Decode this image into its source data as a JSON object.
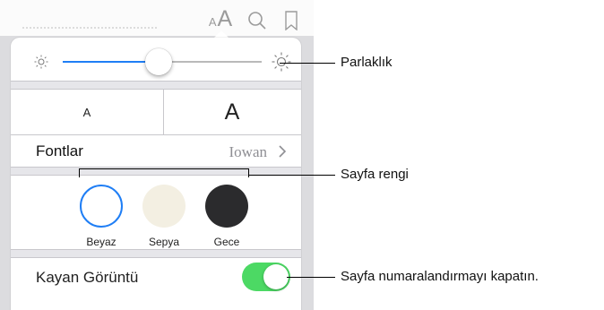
{
  "toolbar": {
    "font_small_glyph": "A",
    "font_large_glyph": "A",
    "icons": [
      "font-size-icon",
      "search-icon",
      "bookmark-icon"
    ]
  },
  "brightness": {
    "level": 0.48,
    "icons": [
      "sun-small-icon",
      "sun-large-icon"
    ]
  },
  "font_size": {
    "smaller_label": "A",
    "larger_label": "A"
  },
  "fonts": {
    "label": "Fontlar",
    "value": "Iowan"
  },
  "theme": {
    "selected": "Beyaz",
    "options": [
      {
        "label": "Beyaz",
        "color": "#ffffff"
      },
      {
        "label": "Sepya",
        "color": "#f3efe2"
      },
      {
        "label": "Gece",
        "color": "#2b2b2d"
      }
    ]
  },
  "scrolling_view": {
    "label": "Kayan Görüntü",
    "enabled": true
  },
  "callouts": {
    "brightness": "Parlaklık",
    "page_color": "Sayfa rengi",
    "toggle": "Sayfa numaralandırmayı kapatın."
  },
  "colors": {
    "accent": "#1f7ef5",
    "toggle_on": "#4cd964"
  }
}
